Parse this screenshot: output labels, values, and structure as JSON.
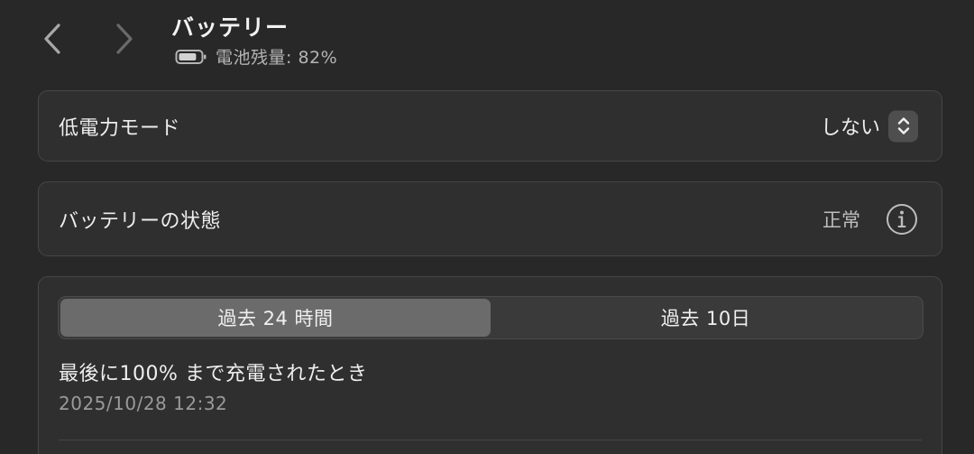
{
  "header": {
    "title": "バッテリー",
    "subtitle": "電池残量: 82%",
    "battery_level": 0.82
  },
  "low_power_mode": {
    "label": "低電力モード",
    "value": "しない"
  },
  "battery_health": {
    "label": "バッテリーの状態",
    "value": "正常"
  },
  "usage": {
    "tabs": [
      {
        "label": "過去 24 時間",
        "selected": true
      },
      {
        "label": "過去 10日",
        "selected": false
      }
    ],
    "last_charge_title": "最後に100% まで充電されたとき",
    "last_charge_date": "2025/10/28 12:32"
  },
  "colors": {
    "background": "#282828",
    "card": "#2f2f2f",
    "active_tab": "#6b6b6b"
  }
}
